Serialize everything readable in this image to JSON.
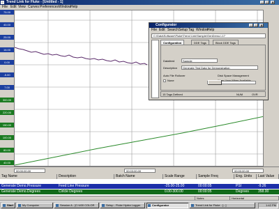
{
  "window": {
    "title": "Trend Link for Fluke - [Untitled - 1]",
    "menu": [
      "File",
      "Edit",
      "View",
      "Curves",
      "Preferences",
      "Window",
      "Help"
    ]
  },
  "chart": {
    "left_labels": [
      {
        "text": "75.00",
        "color": "blue"
      },
      {
        "text": "40.00",
        "color": "blue"
      },
      {
        "text": "25.00",
        "color": "blue"
      },
      {
        "text": "16.00",
        "color": "blue"
      },
      {
        "text": "0.00",
        "color": "blue"
      },
      {
        "text": "-5.00",
        "color": "blue"
      },
      {
        "text": "7.00",
        "color": "blue"
      },
      {
        "text": "300.00",
        "color": "green"
      },
      {
        "text": "220.00",
        "color": "green"
      },
      {
        "text": "150.00",
        "color": "green"
      },
      {
        "text": "100.00",
        "color": "green"
      },
      {
        "text": "80.00",
        "color": "green"
      },
      {
        "text": "40.00",
        "color": "green"
      }
    ],
    "pressure_color": "#5a2a6a",
    "degrees_color": "#2a8a2a"
  },
  "timebar": {
    "start": "00:00:00.00",
    "mid": "00:03:00.00",
    "end": "00:00:00.00"
  },
  "table": {
    "headers": [
      "Tag Name",
      "Description",
      "Batch Name",
      "Scale Range",
      "Sample Freq",
      "Eng. Units",
      "Last Value"
    ],
    "rows": [
      {
        "tag": "Generate Demo.Pressure",
        "desc": "Feed Line Pressure",
        "batch": "",
        "range": "-25.00-25.00",
        "freq": "00:00:05",
        "units": "PSI",
        "last": "-9.26",
        "style": "blue"
      },
      {
        "tag": "Generate Demo.Degrees",
        "desc": "Cirlcle Degrees",
        "batch": "",
        "range": "0.00-300.00",
        "freq": "00:00:05",
        "units": "Degrees",
        "last": "358.00",
        "style": "green"
      }
    ]
  },
  "status": {
    "panes": [
      "",
      "Notes",
      "Horizontal"
    ]
  },
  "taskbar": {
    "start": "Start",
    "items": [
      "My Computer",
      "Session A - [C:\\400 COLOR",
      "Setup - Fluke Hydra Logger",
      "Configurator",
      "Trend Link for Fluke - [...]"
    ],
    "active_index": 3,
    "clock": "1:42 PM"
  },
  "configurator": {
    "title": "Configurator",
    "menu": [
      "File",
      "Edit",
      "Search",
      "Setup",
      "Tag",
      "Window",
      "Help"
    ],
    "path": "C:\\Data\\Software\\Fluke\\Trend Link\\Sample\\GenDemo.L17",
    "tabs": [
      "Configuration",
      "DDE Tags",
      "Block DDE Tags"
    ],
    "active_tab": 1,
    "fields": {
      "datafeed_label": "Datafeed",
      "datafeed_value": "Sample",
      "description_label": "Description",
      "description_value": "Generate Test Data for Demonstration",
      "auto_file_rollover": "Auto File Rollover",
      "none": "None",
      "disk_space": "Disk Space Management",
      "warn_when": "Warn User When Available"
    },
    "statusbar": {
      "tags_defined": "15 Tags Defined",
      "num": "NUM",
      "ovr": "OVR"
    }
  }
}
